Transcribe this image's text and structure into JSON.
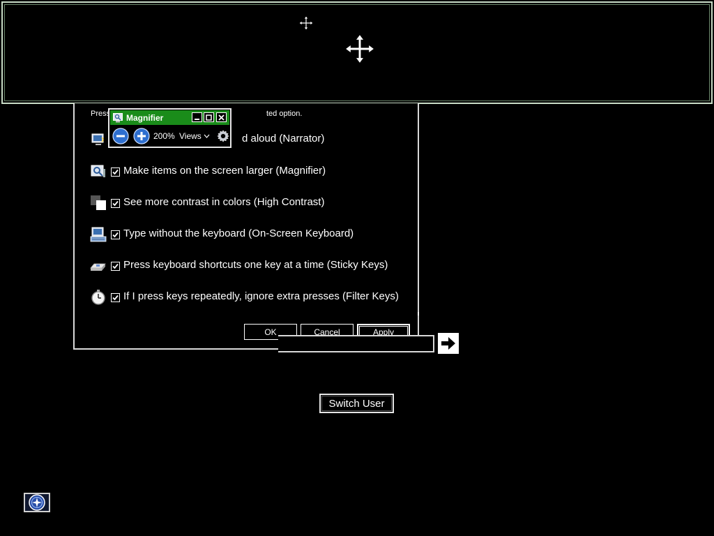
{
  "dialog": {
    "hint_start": "Press",
    "hint_end": "ted option.",
    "options": [
      {
        "label": "d aloud (Narrator)",
        "checked": false,
        "icon": "narrator-icon"
      },
      {
        "label": "Make items on the screen larger (Magnifier)",
        "checked": true,
        "icon": "magnifier-icon"
      },
      {
        "label": "See more contrast in colors (High Contrast)",
        "checked": true,
        "icon": "high-contrast-icon"
      },
      {
        "label": "Type without the keyboard (On-Screen Keyboard)",
        "checked": true,
        "icon": "on-screen-keyboard-icon"
      },
      {
        "label": "Press keyboard shortcuts one key at a time (Sticky Keys)",
        "checked": true,
        "icon": "sticky-keys-icon"
      },
      {
        "label": "If I press keys repeatedly, ignore extra presses (Filter Keys)",
        "checked": true,
        "icon": "filter-keys-icon"
      }
    ],
    "ok_label": "OK",
    "cancel_label": "Cancel",
    "apply_label": "Apply"
  },
  "magnifier": {
    "title": "Magnifier",
    "zoom_level": "200%",
    "views_label": "Views"
  },
  "logon": {
    "switch_user_label": "Switch User"
  },
  "colors": {
    "magnifier_titlebar": "#1a8c1a",
    "lens_border": "#c9dcc7",
    "background": "#000000"
  }
}
